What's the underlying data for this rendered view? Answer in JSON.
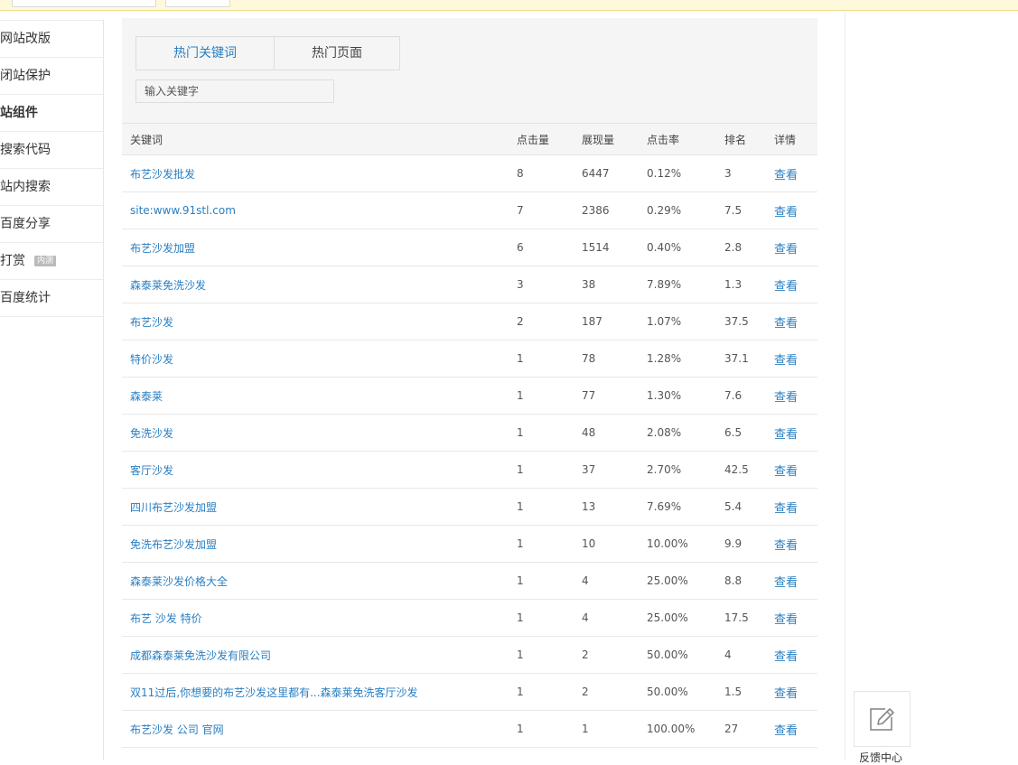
{
  "sidebar": {
    "items": [
      {
        "label": "网站改版",
        "bold": false,
        "badge": ""
      },
      {
        "label": "闭站保护",
        "bold": false,
        "badge": ""
      },
      {
        "label": "站组件",
        "bold": true,
        "badge": ""
      },
      {
        "label": "搜索代码",
        "bold": false,
        "badge": ""
      },
      {
        "label": "站内搜索",
        "bold": false,
        "badge": ""
      },
      {
        "label": "百度分享",
        "bold": false,
        "badge": ""
      },
      {
        "label": "打赏",
        "bold": false,
        "badge": "内测"
      },
      {
        "label": "百度统计",
        "bold": false,
        "badge": ""
      }
    ]
  },
  "tabs": {
    "hot_keywords": "热门关键词",
    "hot_pages": "热门页面"
  },
  "search": {
    "placeholder": "输入关键字"
  },
  "table": {
    "headers": {
      "keyword": "关键词",
      "clicks": "点击量",
      "impressions": "展现量",
      "ctr": "点击率",
      "rank": "排名",
      "details": "详情"
    },
    "rows": [
      {
        "keyword": "布艺沙发批发",
        "clicks": "8",
        "impressions": "6447",
        "ctr": "0.12%",
        "rank": "3",
        "details": "查看"
      },
      {
        "keyword": "site:www.91stl.com",
        "clicks": "7",
        "impressions": "2386",
        "ctr": "0.29%",
        "rank": "7.5",
        "details": "查看"
      },
      {
        "keyword": "布艺沙发加盟",
        "clicks": "6",
        "impressions": "1514",
        "ctr": "0.40%",
        "rank": "2.8",
        "details": "查看"
      },
      {
        "keyword": "森泰莱免洗沙发",
        "clicks": "3",
        "impressions": "38",
        "ctr": "7.89%",
        "rank": "1.3",
        "details": "查看"
      },
      {
        "keyword": "布艺沙发",
        "clicks": "2",
        "impressions": "187",
        "ctr": "1.07%",
        "rank": "37.5",
        "details": "查看"
      },
      {
        "keyword": "特价沙发",
        "clicks": "1",
        "impressions": "78",
        "ctr": "1.28%",
        "rank": "37.1",
        "details": "查看"
      },
      {
        "keyword": "森泰莱",
        "clicks": "1",
        "impressions": "77",
        "ctr": "1.30%",
        "rank": "7.6",
        "details": "查看"
      },
      {
        "keyword": "免洗沙发",
        "clicks": "1",
        "impressions": "48",
        "ctr": "2.08%",
        "rank": "6.5",
        "details": "查看"
      },
      {
        "keyword": "客厅沙发",
        "clicks": "1",
        "impressions": "37",
        "ctr": "2.70%",
        "rank": "42.5",
        "details": "查看"
      },
      {
        "keyword": "四川布艺沙发加盟",
        "clicks": "1",
        "impressions": "13",
        "ctr": "7.69%",
        "rank": "5.4",
        "details": "查看"
      },
      {
        "keyword": "免洗布艺沙发加盟",
        "clicks": "1",
        "impressions": "10",
        "ctr": "10.00%",
        "rank": "9.9",
        "details": "查看"
      },
      {
        "keyword": "森泰莱沙发价格大全",
        "clicks": "1",
        "impressions": "4",
        "ctr": "25.00%",
        "rank": "8.8",
        "details": "查看"
      },
      {
        "keyword": "布艺 沙发 特价",
        "clicks": "1",
        "impressions": "4",
        "ctr": "25.00%",
        "rank": "17.5",
        "details": "查看"
      },
      {
        "keyword": "成都森泰莱免洗沙发有限公司",
        "clicks": "1",
        "impressions": "2",
        "ctr": "50.00%",
        "rank": "4",
        "details": "查看"
      },
      {
        "keyword": "双11过后,你想要的布艺沙发这里都有...森泰莱免洗客厅沙发",
        "clicks": "1",
        "impressions": "2",
        "ctr": "50.00%",
        "rank": "1.5",
        "details": "查看"
      },
      {
        "keyword": "布艺沙发 公司 官网",
        "clicks": "1",
        "impressions": "1",
        "ctr": "100.00%",
        "rank": "27",
        "details": "查看"
      }
    ]
  },
  "feedback": {
    "icon": "edit-icon",
    "label": "反馈中心"
  },
  "colors": {
    "link": "#2a7fc2",
    "panel_bg": "#f5f5f5",
    "notice_bar": "#fff9db"
  }
}
